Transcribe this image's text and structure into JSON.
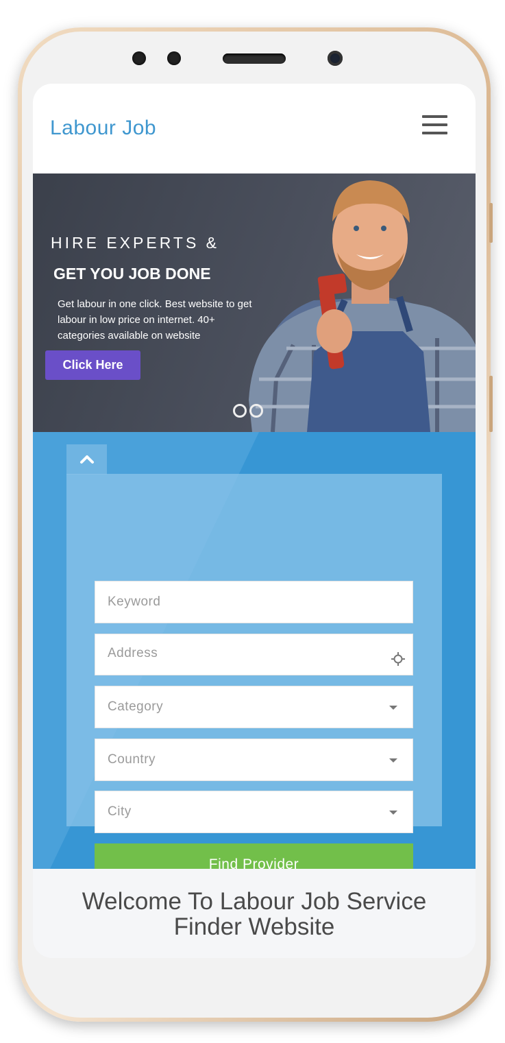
{
  "navbar": {
    "brand": "Labour Job",
    "menu_icon": "hamburger-icon"
  },
  "hero": {
    "subtitle": "HIRE EXPERTS &",
    "title": "GET YOU JOB DONE",
    "description": "Get labour in one click. Best website to get labour in low price on internet. 40+ categories available on website",
    "button_label": "Click Here",
    "slider": {
      "slide_count": 2
    }
  },
  "search": {
    "toggle_icon": "chevron-up-icon",
    "keyword_placeholder": "Keyword",
    "address_placeholder": "Address",
    "address_icon": "crosshair-icon",
    "category_placeholder": "Category",
    "country_placeholder": "Country",
    "city_placeholder": "City",
    "submit_label": "Find Provider"
  },
  "welcome": {
    "line1": "Welcome To Labour Job Service",
    "line2": "Finder Website"
  },
  "colors": {
    "brand": "#3f97cf",
    "hero_button": "#6a4fc8",
    "search_bg": "#3796d4",
    "submit_button": "#72bf4a"
  }
}
